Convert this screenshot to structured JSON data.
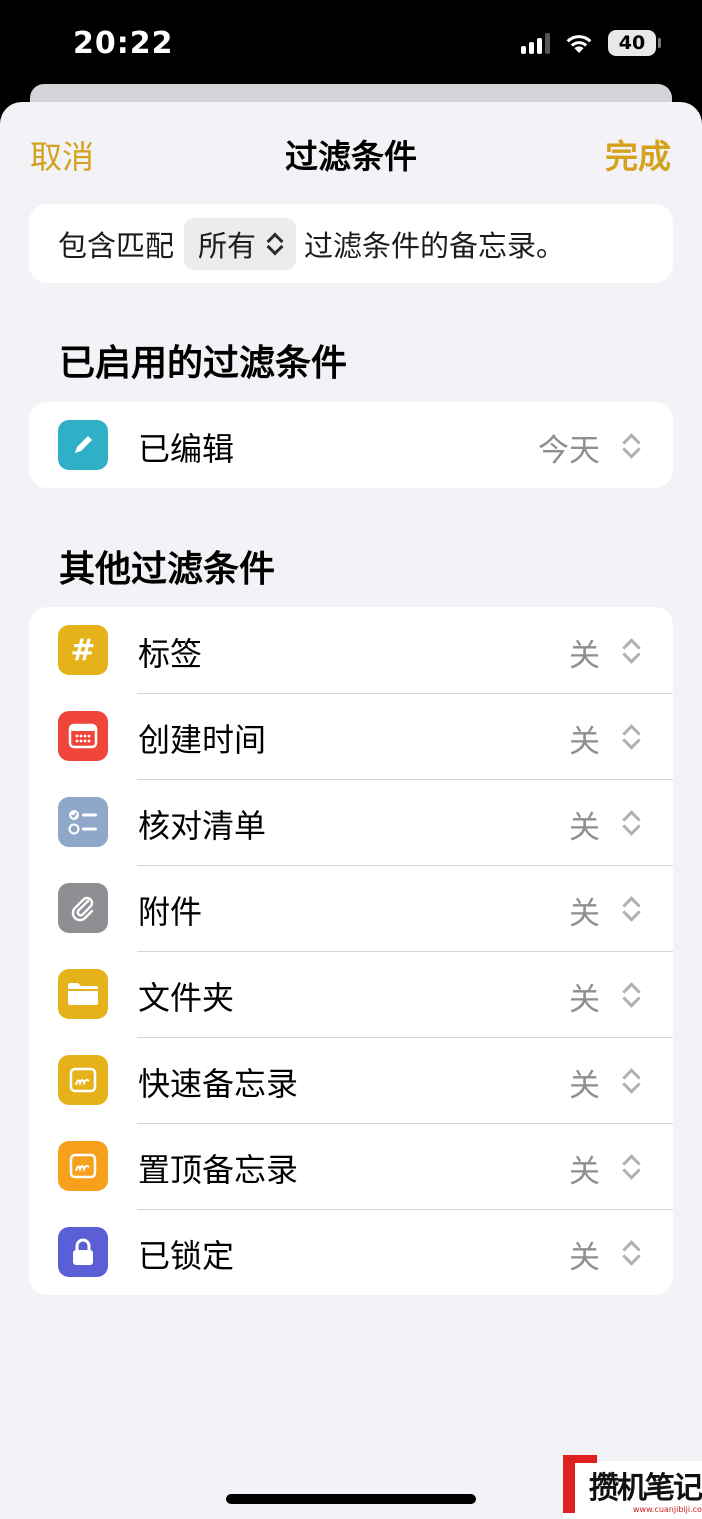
{
  "status_bar": {
    "time": "20:22",
    "battery": "40"
  },
  "nav": {
    "cancel": "取消",
    "title": "过滤条件",
    "done": "完成"
  },
  "match": {
    "prefix": "包含匹配",
    "selected": "所有",
    "suffix": "过滤条件的备忘录。"
  },
  "enabled_section": {
    "header": "已启用的过滤条件",
    "items": [
      {
        "label": "已编辑",
        "value": "今天",
        "icon": "pencil-icon",
        "color": "#30b0c7"
      }
    ]
  },
  "other_section": {
    "header": "其他过滤条件",
    "items": [
      {
        "label": "标签",
        "value": "关",
        "icon": "hashtag-icon",
        "color": "#e6b21a"
      },
      {
        "label": "创建时间",
        "value": "关",
        "icon": "calendar-icon",
        "color": "#f0453a"
      },
      {
        "label": "核对清单",
        "value": "关",
        "icon": "checklist-icon",
        "color": "#8fa7c9"
      },
      {
        "label": "附件",
        "value": "关",
        "icon": "paperclip-icon",
        "color": "#8e8e93"
      },
      {
        "label": "文件夹",
        "value": "关",
        "icon": "folder-icon",
        "color": "#e6b21a"
      },
      {
        "label": "快速备忘录",
        "value": "关",
        "icon": "quick-note-icon",
        "color": "#e6b21a"
      },
      {
        "label": "置顶备忘录",
        "value": "关",
        "icon": "pinned-note-icon",
        "color": "#f7a01c"
      },
      {
        "label": "已锁定",
        "value": "关",
        "icon": "lock-icon",
        "color": "#5b5fd6"
      }
    ]
  },
  "watermark": {
    "text": "攒机笔记",
    "url": "www.cuanjibiji.com"
  }
}
